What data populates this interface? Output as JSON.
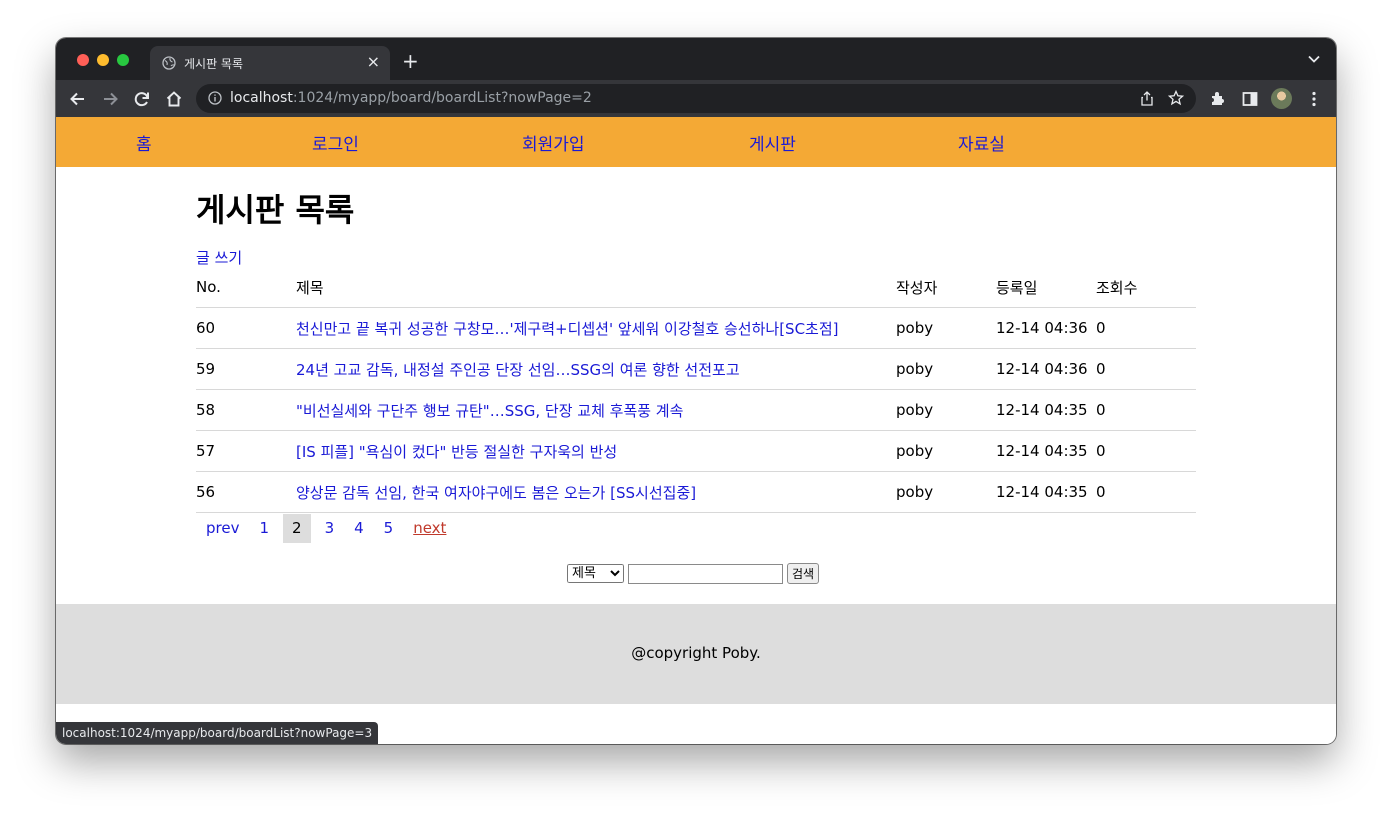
{
  "browser": {
    "tab_title": "게시판 목록",
    "url_host": "localhost",
    "url_path": ":1024/myapp/board/boardList?nowPage=2",
    "status_url": "localhost:1024/myapp/board/boardList?nowPage=3"
  },
  "nav": {
    "items": [
      "홈",
      "로그인",
      "회원가입",
      "게시판",
      "자료실"
    ]
  },
  "page": {
    "title": "게시판 목록",
    "write_link": "글 쓰기"
  },
  "table": {
    "headers": [
      "No.",
      "제목",
      "작성자",
      "등록일",
      "조회수"
    ],
    "rows": [
      {
        "no": "60",
        "title": "천신만고 끝 복귀 성공한 구창모…'제구력+디셉션' 앞세워 이강철호 승선하나[SC초점]",
        "author": "poby",
        "date": "12-14 04:36",
        "views": "0"
      },
      {
        "no": "59",
        "title": "24년 고교 감독, 내정설 주인공 단장 선임…SSG의 여론 향한 선전포고",
        "author": "poby",
        "date": "12-14 04:36",
        "views": "0"
      },
      {
        "no": "58",
        "title": "\"비선실세와 구단주 행보 규탄\"…SSG, 단장 교체 후폭풍 계속",
        "author": "poby",
        "date": "12-14 04:35",
        "views": "0"
      },
      {
        "no": "57",
        "title": "[IS 피플] \"욕심이 컸다\" 반등 절실한 구자욱의 반성",
        "author": "poby",
        "date": "12-14 04:35",
        "views": "0"
      },
      {
        "no": "56",
        "title": "양상문 감독 선임, 한국 여자야구에도 봄은 오는가 [SS시선집중]",
        "author": "poby",
        "date": "12-14 04:35",
        "views": "0"
      }
    ]
  },
  "pager": {
    "prev": "prev",
    "pages": [
      "1",
      "2",
      "3",
      "4",
      "5"
    ],
    "current": "2",
    "next": "next"
  },
  "search": {
    "selected_option": "제목",
    "input_value": "",
    "button_label": "검색"
  },
  "footer": {
    "text": "@copyright Poby."
  },
  "colors": {
    "nav_bg": "#f4a935",
    "link": "#1a1ad6",
    "footer_bg": "#dddddd"
  }
}
